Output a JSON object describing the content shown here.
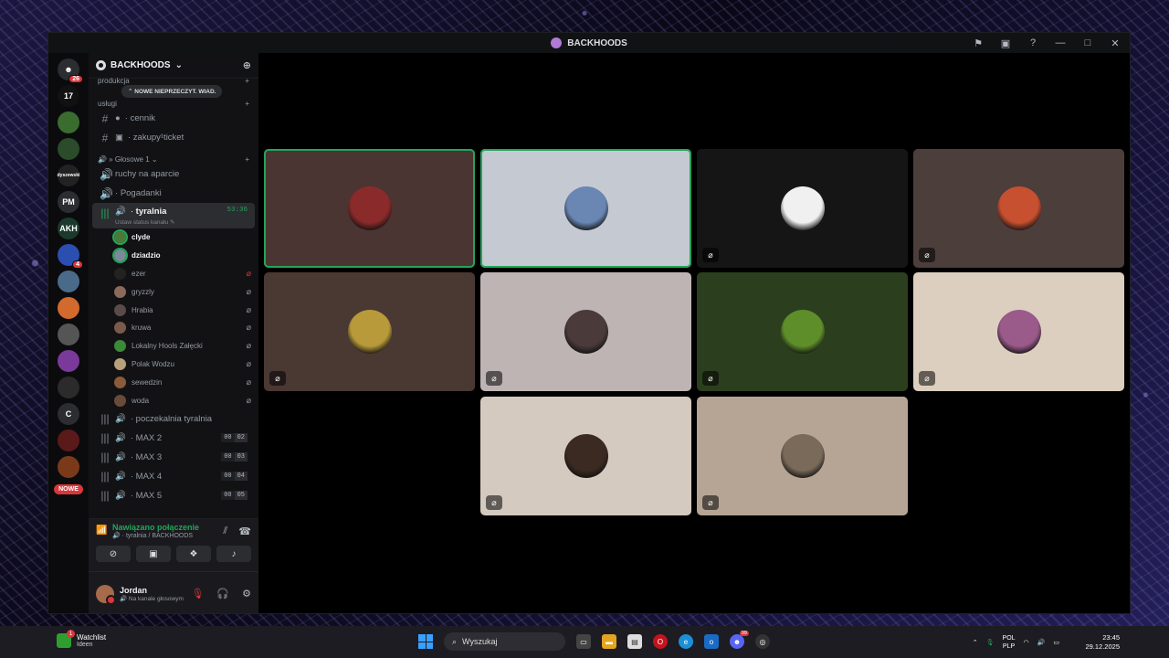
{
  "window": {
    "title": "BACKHOODS",
    "controls": [
      "flag-icon",
      "screen-icon",
      "help-icon",
      "minimize-icon",
      "maximize-icon",
      "close-icon"
    ]
  },
  "rail": {
    "home_badge": "26",
    "servers": [
      {
        "label": "17",
        "badge": ""
      },
      {
        "label": "",
        "badge": ""
      },
      {
        "label": "",
        "badge": ""
      },
      {
        "label": "dyszewski",
        "badge": ""
      },
      {
        "label": "PM",
        "badge": ""
      },
      {
        "label": "AKH",
        "badge": ""
      },
      {
        "label": "",
        "badge": "4"
      },
      {
        "label": "",
        "badge": ""
      },
      {
        "label": "",
        "badge": ""
      },
      {
        "label": "",
        "badge": ""
      },
      {
        "label": "",
        "badge": ""
      },
      {
        "label": "",
        "badge": ""
      },
      {
        "label": "C",
        "badge": ""
      },
      {
        "label": "",
        "badge": ""
      },
      {
        "label": "",
        "badge": ""
      }
    ],
    "nowe_label": "NOWE"
  },
  "sidebar": {
    "guild_name": "BACKHOODS",
    "new_msgs_pill": "NOWE NIEPRZECZYT. WIAD.",
    "category_produkcja": "produkcja",
    "category_uslugi": "usługi",
    "text_channels": [
      {
        "name": "cennik"
      },
      {
        "name": "zakupy¹ticket"
      }
    ],
    "category_voice": "Głosowe 1",
    "voice_channels_top": [
      {
        "name": "ruchy na aparcie"
      },
      {
        "name": "Pogadanki"
      }
    ],
    "active_channel": {
      "name": "tyralnia",
      "timer": "53:36",
      "status_hint": "Ustaw status kanału"
    },
    "members": [
      {
        "name": "clyde",
        "bold": true,
        "speaking": true,
        "mic": ""
      },
      {
        "name": "dziadzio",
        "bold": true,
        "speaking": true,
        "mic": ""
      },
      {
        "name": "ezer",
        "bold": false,
        "speaking": false,
        "mic": "deafened"
      },
      {
        "name": "gryzzly",
        "bold": false,
        "speaking": false,
        "mic": "muted"
      },
      {
        "name": "Hrabia",
        "bold": false,
        "speaking": false,
        "mic": "muted"
      },
      {
        "name": "kruwa",
        "bold": false,
        "speaking": false,
        "mic": "muted"
      },
      {
        "name": "Lokalny Hools Załęcki",
        "bold": false,
        "speaking": false,
        "mic": "muted"
      },
      {
        "name": "Polak Wodzu",
        "bold": false,
        "speaking": false,
        "mic": "muted"
      },
      {
        "name": "sewedzin",
        "bold": false,
        "speaking": false,
        "mic": "muted"
      },
      {
        "name": "woda",
        "bold": false,
        "speaking": false,
        "mic": "muted"
      }
    ],
    "voice_channels_bottom": [
      {
        "name": "poczekalnia tyralnia",
        "count": "",
        "limit": ""
      },
      {
        "name": "MAX 2",
        "count": "00",
        "limit": "02"
      },
      {
        "name": "MAX 3",
        "count": "00",
        "limit": "03"
      },
      {
        "name": "MAX 4",
        "count": "00",
        "limit": "04"
      },
      {
        "name": "MAX 5",
        "count": "00",
        "limit": "05"
      }
    ]
  },
  "voice_panel": {
    "status": "Nawiązano połączenie",
    "location": "tyralnia / BACKHOODS"
  },
  "user": {
    "name": "Jordan",
    "status": "Na kanale głosowym"
  },
  "tiles": [
    {
      "bg": "#4a3532",
      "avatar": "#8b2a2a",
      "speaking": true,
      "muted": false
    },
    {
      "bg": "#c5c9d1",
      "avatar": "#6a86b2",
      "speaking": true,
      "muted": false
    },
    {
      "bg": "#151515",
      "avatar": "#f0f0f0",
      "speaking": false,
      "muted": true
    },
    {
      "bg": "#4b3e3b",
      "avatar": "#c6502f",
      "speaking": false,
      "muted": true
    },
    {
      "bg": "#4a3833",
      "avatar": "#b89a3a",
      "speaking": false,
      "muted": true
    },
    {
      "bg": "#bfb4b4",
      "avatar": "#4a3a3a",
      "speaking": false,
      "muted": true
    },
    {
      "bg": "#2b3f1e",
      "avatar": "#5e8e2a",
      "speaking": false,
      "muted": true
    },
    {
      "bg": "#dccfbf",
      "avatar": "#9a5a8a",
      "speaking": false,
      "muted": true
    },
    {
      "bg": "#d5cabf",
      "avatar": "#3b2a22",
      "speaking": false,
      "muted": true
    },
    {
      "bg": "#b6a595",
      "avatar": "#7a6a5a",
      "speaking": false,
      "muted": true
    }
  ],
  "taskbar": {
    "widget_title": "Watchlist",
    "widget_sub": "Ideen",
    "widget_badge": "1",
    "search_placeholder": "Wyszukaj",
    "discord_badge": "99",
    "lang_top": "POL",
    "lang_bottom": "PLP",
    "time": "23:45",
    "date": "29.12.2025"
  }
}
